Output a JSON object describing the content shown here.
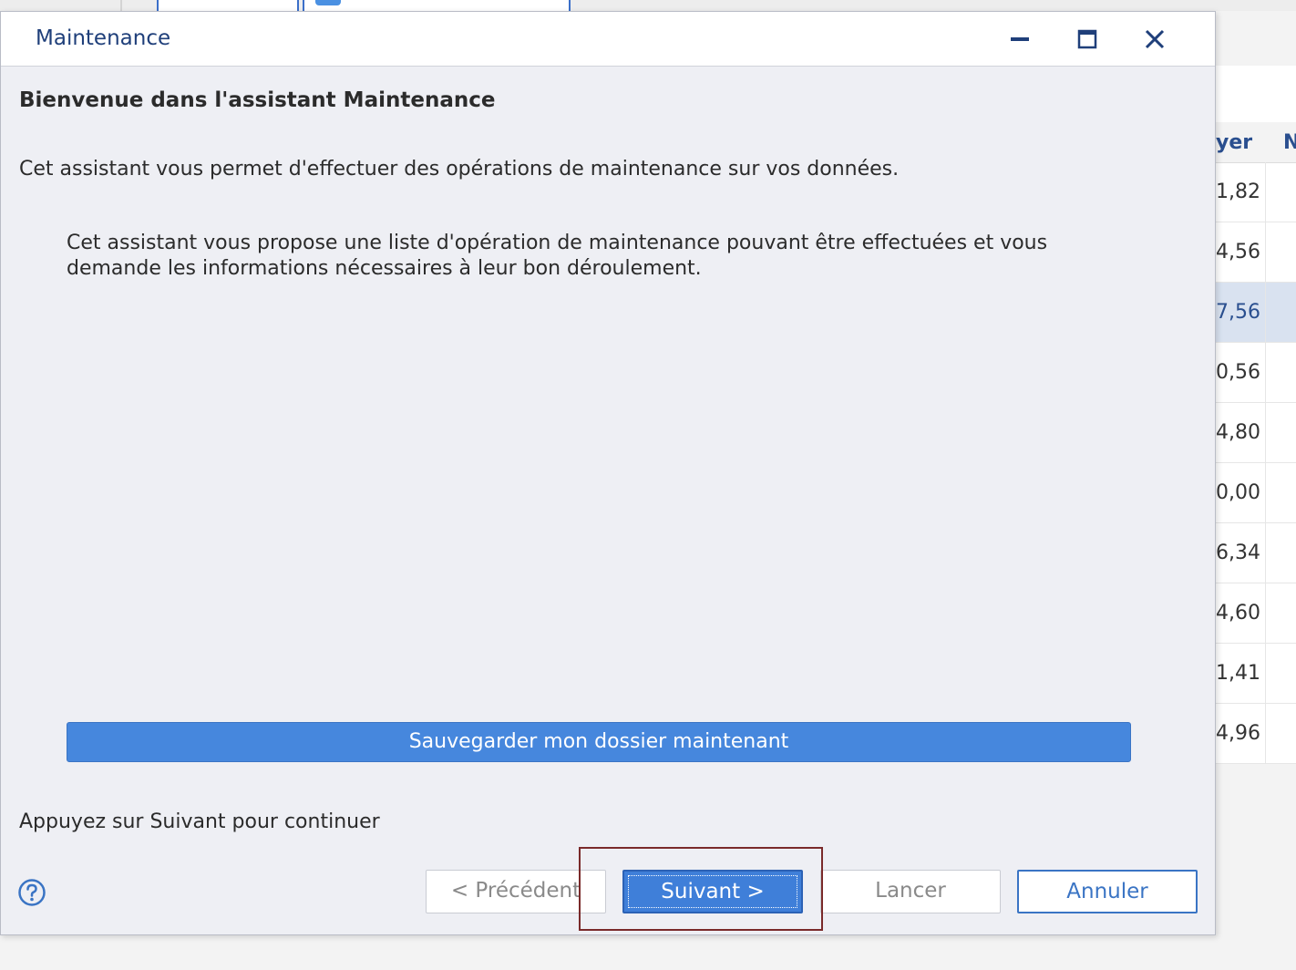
{
  "background": {
    "column_headers": [
      "yer",
      "N"
    ],
    "rows": [
      {
        "value": "1,82",
        "selected": false
      },
      {
        "value": "4,56",
        "selected": false
      },
      {
        "value": "7,56",
        "selected": true
      },
      {
        "value": "0,56",
        "selected": false
      },
      {
        "value": "4,80",
        "selected": false
      },
      {
        "value": "0,00",
        "selected": false
      },
      {
        "value": "6,34",
        "selected": false
      },
      {
        "value": "4,60",
        "selected": false
      },
      {
        "value": "1,41",
        "selected": false
      },
      {
        "value": "4,96",
        "selected": false
      }
    ]
  },
  "dialog": {
    "title": "Maintenance",
    "window_controls": [
      "minimize-icon",
      "maximize-icon",
      "close-icon"
    ],
    "heading": "Bienvenue dans l'assistant Maintenance",
    "intro": "Cet assistant vous permet d'effectuer des opérations de maintenance sur vos données.",
    "description": "Cet assistant vous propose une liste d'opération de maintenance pouvant être effectuées et vous demande les informations nécessaires à leur bon déroulement.",
    "save_button": "Sauvegarder mon dossier maintenant",
    "hint": "Appuyez sur Suivant pour continuer",
    "buttons": {
      "previous": "< Précédent",
      "next": "Suivant >",
      "launch": "Lancer",
      "cancel": "Annuler"
    }
  },
  "colors": {
    "accent": "#4687dd",
    "title_text": "#1f3f7a",
    "highlight_border": "#7a2a2a"
  }
}
